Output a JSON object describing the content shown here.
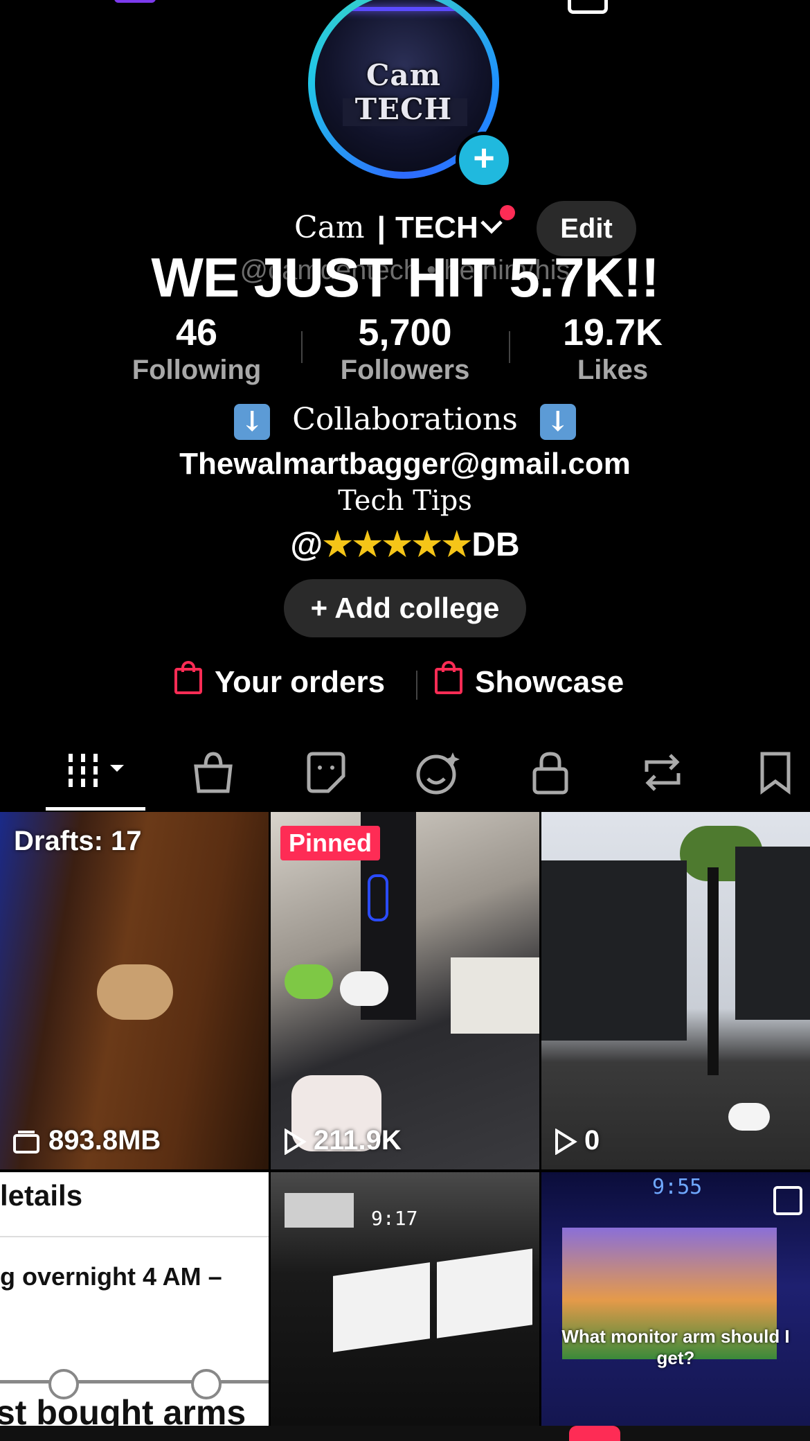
{
  "profile": {
    "display_name_first": "Cam",
    "display_name_second": "TECH",
    "username": "@camdentech • he/him/his",
    "edit_label": "Edit",
    "avatar_text": "Cam TECH",
    "overlay_text": "WE JUST HIT 5.7K!!"
  },
  "stats": [
    {
      "value": "46",
      "label": "Following"
    },
    {
      "value": "5,700",
      "label": "Followers"
    },
    {
      "value": "19.7K",
      "label": "Likes"
    }
  ],
  "bio": {
    "collab": "𝕮𝖔𝖑𝖑𝖆𝖇𝖔𝖗𝖆𝖙𝖎𝖔𝖓𝖘",
    "collab_plain": "Collaborations",
    "email": "Thewalmartbagger@gmail.com",
    "tips": "Tech Tips",
    "stars_line": "@⭐⭐⭐⭐⭐DB"
  },
  "add_college_label": "+ Add college",
  "shop": {
    "orders_label": "Your orders",
    "showcase_label": "Showcase"
  },
  "grid": {
    "drafts_label": "Drafts: 17",
    "drafts_size": "893.8MB",
    "pinned_label": "Pinned",
    "pinned_views": "211.9K",
    "third_views": "0",
    "row2_text_1": "letails",
    "row2_text_2": "g overnight 4 AM –",
    "row2_text_3": "st bought arms",
    "row2_clock": "9:17",
    "row2_clock_2": "9:55",
    "row2_caption": "What monitor arm should I get?"
  },
  "colors": {
    "accent_red": "#fe2c55",
    "accent_blue": "#20b9de",
    "pill_bg": "#2a2a2a"
  }
}
